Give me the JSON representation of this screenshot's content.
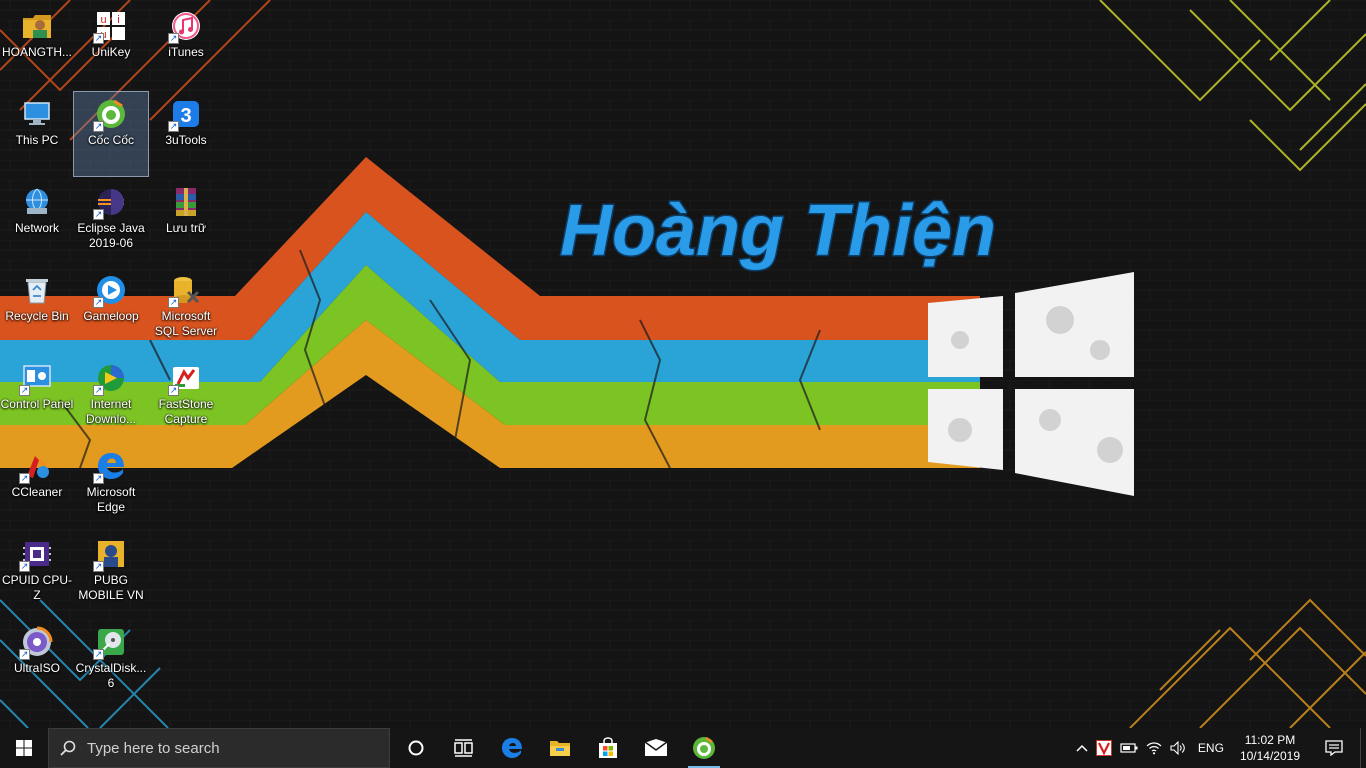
{
  "wallpaper": {
    "title": "Hoàng Thiện",
    "colors": {
      "red": "#d9531e",
      "blue": "#2aa3d7",
      "green": "#7cc423",
      "orange": "#e39b1f",
      "title": "#2a9be8"
    }
  },
  "desktop_icons": [
    {
      "label": "HOANGTH...",
      "icon": "user-folder-icon",
      "shortcut": false
    },
    {
      "label": "UniKey",
      "icon": "unikey-icon",
      "shortcut": true
    },
    {
      "label": "iTunes",
      "icon": "itunes-icon",
      "shortcut": true
    },
    {
      "label": "This PC",
      "icon": "this-pc-icon",
      "shortcut": false
    },
    {
      "label": "Cốc Cốc",
      "icon": "coccoc-icon",
      "shortcut": true
    },
    {
      "label": "3uTools",
      "icon": "3utools-icon",
      "shortcut": true
    },
    {
      "label": "Network",
      "icon": "network-icon",
      "shortcut": false
    },
    {
      "label": "Eclipse Java 2019-06",
      "icon": "eclipse-icon",
      "shortcut": true
    },
    {
      "label": "Lưu trữ",
      "icon": "winrar-icon",
      "shortcut": false
    },
    {
      "label": "Recycle Bin",
      "icon": "recycle-bin-icon",
      "shortcut": false
    },
    {
      "label": "Gameloop",
      "icon": "gameloop-icon",
      "shortcut": true
    },
    {
      "label": "Microsoft SQL Server ...",
      "icon": "sql-server-icon",
      "shortcut": true
    },
    {
      "label": "Control Panel",
      "icon": "control-panel-icon",
      "shortcut": true
    },
    {
      "label": "Internet Downlo...",
      "icon": "idm-icon",
      "shortcut": true
    },
    {
      "label": "FastStone Capture",
      "icon": "faststone-icon",
      "shortcut": true
    },
    {
      "label": "CCleaner",
      "icon": "ccleaner-icon",
      "shortcut": true
    },
    {
      "label": "Microsoft Edge",
      "icon": "edge-icon",
      "shortcut": true
    },
    {
      "label": "CPUID CPU-Z",
      "icon": "cpuz-icon",
      "shortcut": true
    },
    {
      "label": "PUBG MOBILE VN",
      "icon": "pubg-icon",
      "shortcut": true
    },
    {
      "label": "UltraISO",
      "icon": "ultraiso-icon",
      "shortcut": true
    },
    {
      "label": "CrystalDisk... 6",
      "icon": "crystaldisk-icon",
      "shortcut": true
    }
  ],
  "taskbar": {
    "search_placeholder": "Type here to search",
    "pinned": [
      "cortana-icon",
      "task-view-icon",
      "edge-icon",
      "file-explorer-icon",
      "store-icon",
      "mail-icon",
      "coccoc-icon"
    ],
    "tray": {
      "language": "ENG",
      "time": "11:02 PM",
      "date": "10/14/2019"
    }
  }
}
